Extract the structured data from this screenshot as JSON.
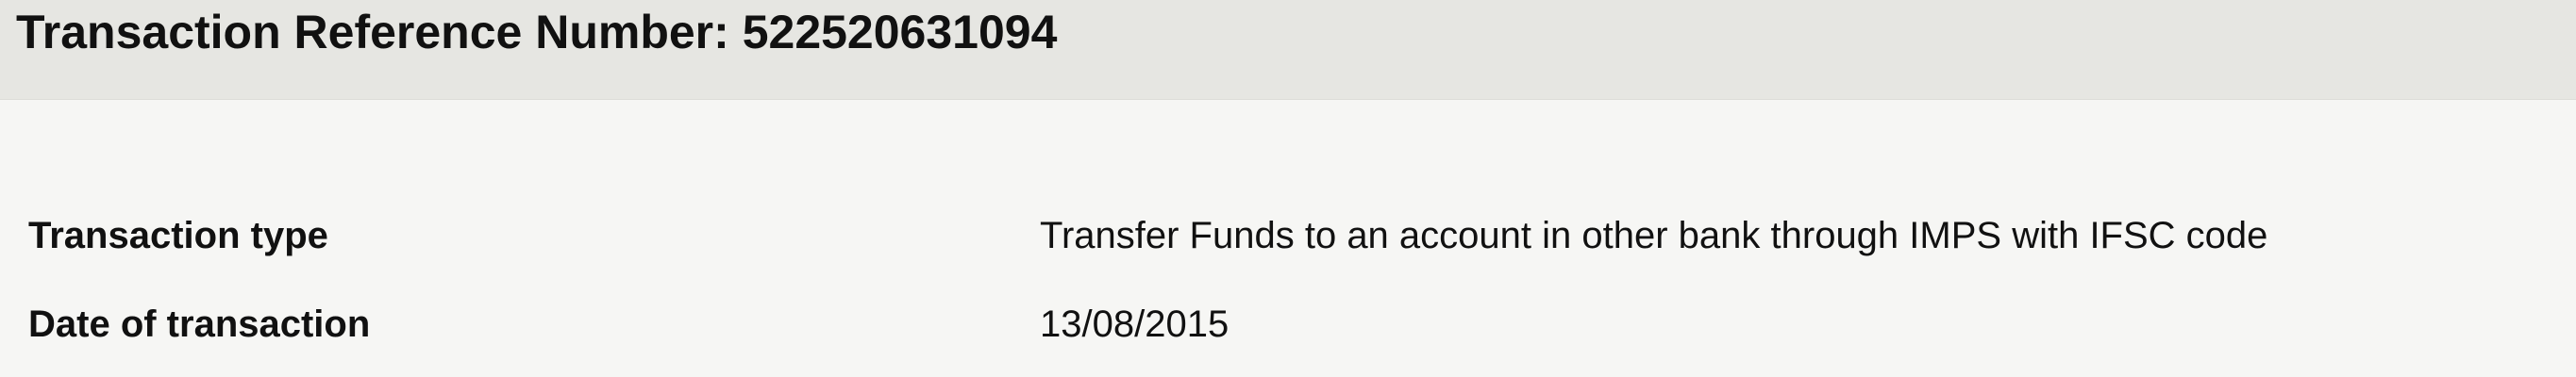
{
  "header": {
    "label": "Transaction Reference Number:",
    "reference_number": "522520631094"
  },
  "details": [
    {
      "label": "Transaction type",
      "value": "Transfer Funds to an account in other bank through IMPS with IFSC code"
    },
    {
      "label": "Date of transaction",
      "value": "13/08/2015"
    }
  ]
}
